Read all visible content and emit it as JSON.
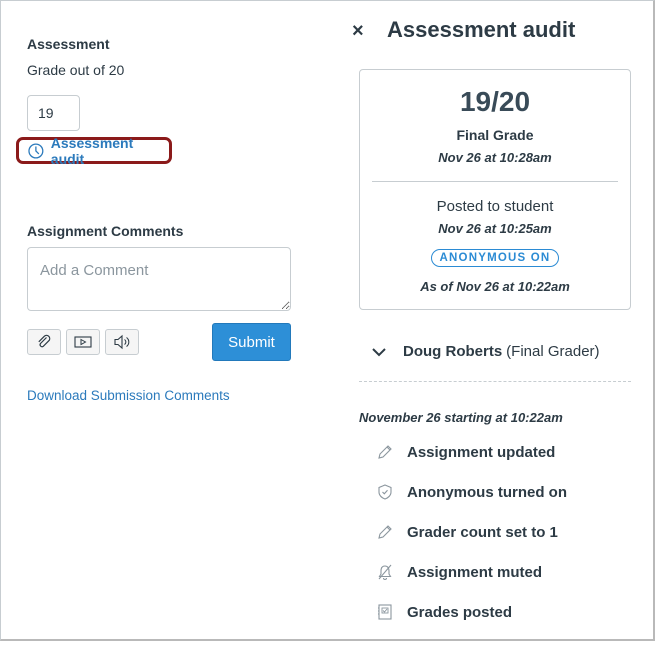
{
  "left_panel": {
    "assessment_label": "Assessment",
    "grade_out_of": "Grade out of 20",
    "grade_value": "19",
    "audit_link_label": "Assessment audit",
    "comments_label": "Assignment Comments",
    "comment_placeholder": "Add a Comment",
    "comment_value": "",
    "tool_buttons": [
      {
        "icon": "paperclip-icon"
      },
      {
        "icon": "media-icon"
      },
      {
        "icon": "audio-icon"
      }
    ],
    "submit_label": "Submit",
    "download_link": "Download Submission Comments"
  },
  "audit_panel": {
    "close_icon": "×",
    "title": "Assessment audit",
    "summary": {
      "score": "19/20",
      "score_label": "Final Grade",
      "score_time": "Nov 26 at 10:28am",
      "posted_label": "Posted to student",
      "posted_time": "Nov 26 at 10:25am",
      "badge": "ANONYMOUS ON",
      "as_of": "As of Nov 26 at 10:22am"
    },
    "grader": {
      "name": "Doug Roberts",
      "role": "(Final Grader)"
    },
    "date_heading": "November 26 starting at 10:22am",
    "events": [
      {
        "icon": "pencil-icon",
        "label": "Assignment updated"
      },
      {
        "icon": "shield-icon",
        "label": "Anonymous turned on"
      },
      {
        "icon": "pencil-icon",
        "label": "Grader count set to 1"
      },
      {
        "icon": "muted-bell-icon",
        "label": "Assignment muted"
      },
      {
        "icon": "gradebook-icon",
        "label": "Grades posted"
      }
    ]
  },
  "colors": {
    "link": "#2b7abc",
    "primary_button": "#2d8fd7",
    "highlight_border": "#8b1a1a",
    "text": "#2d3b45"
  }
}
